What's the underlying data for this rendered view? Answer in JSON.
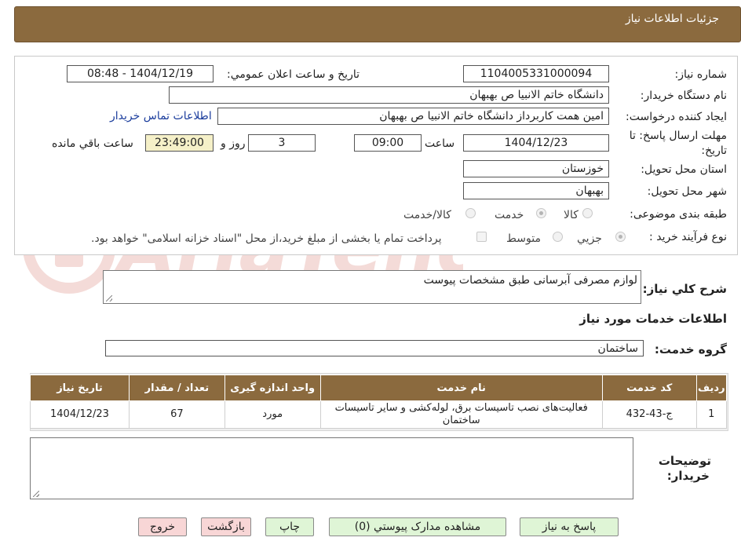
{
  "header": {
    "title": "جزئيات اطلاعات نياز"
  },
  "form": {
    "need_number_label": "شماره نیاز:",
    "need_number": "1104005331000094",
    "announce_label": "تاريخ و ساعت اعلان عمومي:",
    "announce_value": "1404/12/19 - 08:48",
    "buyer_org_label": "نام دستگاه خريدار:",
    "buyer_org": "دانشگاه خاتم الانبیا  ص  بهبهان",
    "creator_label": "ايجاد کننده درخواست:",
    "creator": "امین همت کاربرداز دانشگاه خاتم الانبیا  ص  بهبهان",
    "contact_link": "اطلاعات تماس خريدار",
    "deadline_label_1": "مهلت ارسال پاسخ: تا",
    "deadline_label_2": "تاريخ:",
    "deadline_date": "1404/12/23",
    "hour_label": "ساعت",
    "deadline_time": "09:00",
    "days_value": "3",
    "days_label": "روز و",
    "remaining_time": "23:49:00",
    "remaining_label": "ساعت باقي مانده",
    "province_label": "استان محل تحويل:",
    "province": "خوزستان",
    "city_label": "شهر محل تحويل:",
    "city": "بهبهان",
    "category_label": "طبقه بندی موضوعی:",
    "category_options": [
      "کالا",
      "خدمت",
      "کالا/خدمت"
    ],
    "category_selected": "خدمت",
    "process_label": "نوع فرآيند خريد :",
    "process_options": [
      "جزيي",
      "متوسط"
    ],
    "process_selected": "جزيي",
    "payment_note": "پرداخت تمام یا بخشی از مبلغ خرید،از محل \"اسناد خزانه اسلامی\" خواهد بود."
  },
  "summary": {
    "label": "شرح کلي نياز:",
    "text": "لوازم مصرفی آبرسانی طبق مشخصات پیوست"
  },
  "services": {
    "section_title": "اطلاعات خدمات مورد نياز",
    "group_label": "گروه خدمت:",
    "group_value": "ساختمان",
    "columns": [
      "رديف",
      "کد خدمت",
      "نام خدمت",
      "واحد اندازه گيری",
      "تعداد / مقدار",
      "تاريخ نياز"
    ],
    "rows": [
      {
        "index": "1",
        "code": "ج-43-432",
        "name": "فعالیت‌های نصب تاسیسات برق، لوله‌کشی و سایر تاسیسات ساختمان",
        "unit": "مورد",
        "qty": "67",
        "date": "1404/12/23"
      }
    ]
  },
  "buyer_notes": {
    "label_1": "توضيحات",
    "label_2": "خريدار:"
  },
  "buttons": {
    "reply": "پاسخ به نياز",
    "attachments": "مشاهده مدارک پيوستي (0)",
    "print": "چاپ",
    "back": "بازگشت",
    "exit": "خروج"
  },
  "colors": {
    "header_bg": "#8b6a3e",
    "time_bg": "#f5f0c8",
    "green_button": "#dff5d6",
    "pink_button": "#f8d6d6",
    "link": "#1a3c9c"
  }
}
